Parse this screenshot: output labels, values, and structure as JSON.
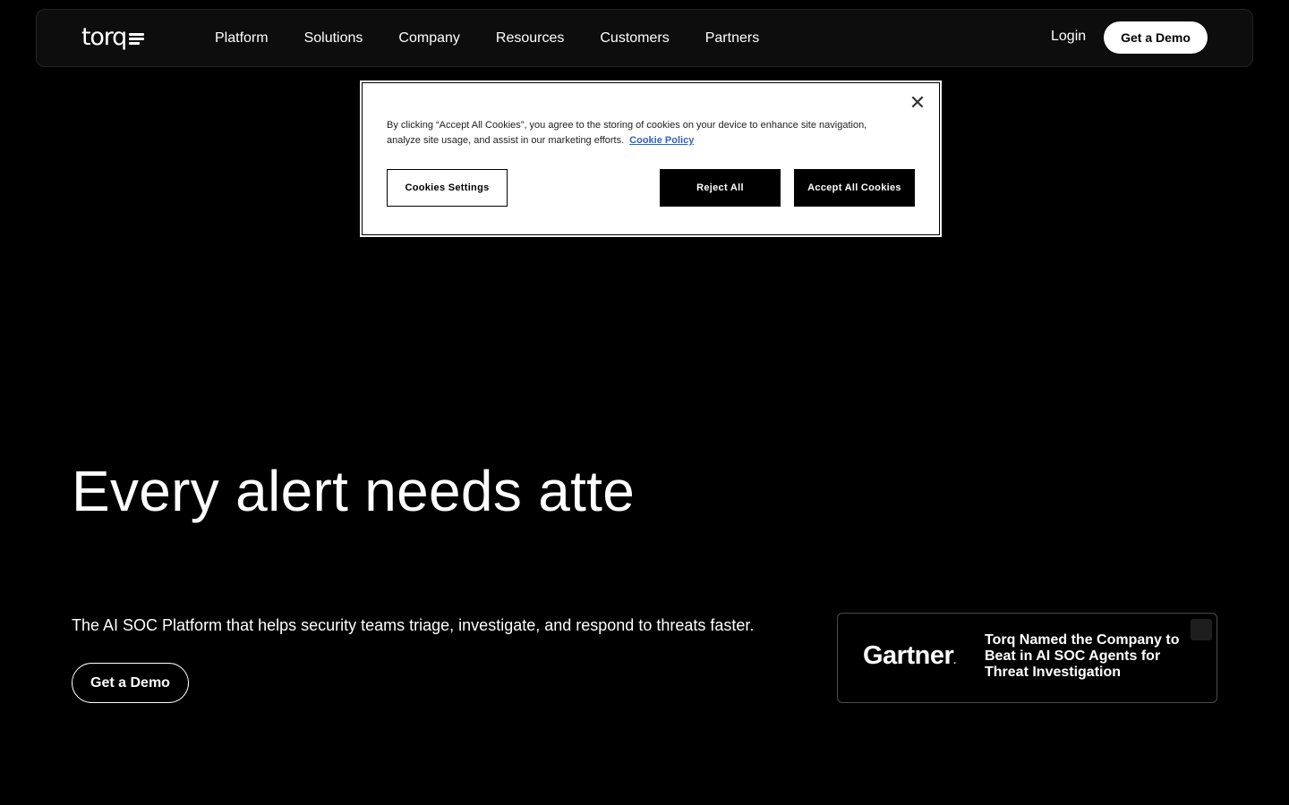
{
  "nav": {
    "logo_text": "torq",
    "links": [
      "Platform",
      "Solutions",
      "Company",
      "Resources",
      "Customers",
      "Partners"
    ],
    "login_label": "Login",
    "cta_label": "Get a Demo"
  },
  "cookie_banner": {
    "text": "By clicking “Accept All Cookies”, you agree to the storing of cookies on your device to enhance site navigation, analyze site usage, and assist in our marketing efforts.",
    "policy_link": "Cookie Policy",
    "close_icon": "close-icon",
    "settings_label": "Cookies Settings",
    "reject_label": "Reject All",
    "accept_label": "Accept All Cookies"
  },
  "hero": {
    "title": "Every alert needs atte",
    "subtitle": "The AI SOC Platform that helps security teams triage, investigate, and respond to threats faster.",
    "cta_label": "Get a Demo"
  },
  "gartner_card": {
    "logo_text": "Gartner",
    "headline": "Torq Named the Company to Beat in AI SOC Agents for Threat Investigation"
  },
  "colors": {
    "background": "#000000",
    "nav_background": "#0d0d0d",
    "link_blue": "#3860be"
  }
}
